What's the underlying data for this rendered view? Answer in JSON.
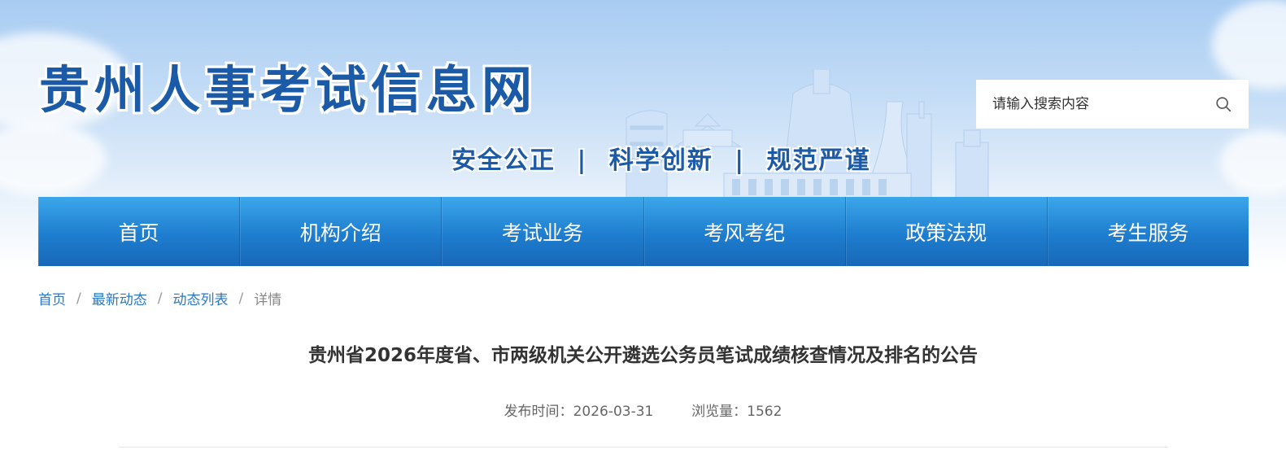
{
  "header": {
    "site_title": "贵州人事考试信息网",
    "slogan": {
      "part1": "安全公正",
      "part2": "科学创新",
      "part3": "规范严谨",
      "separator": "|"
    },
    "search": {
      "placeholder": "请输入搜索内容",
      "icon": "search-icon"
    }
  },
  "nav": {
    "items": [
      {
        "label": "首页"
      },
      {
        "label": "机构介绍"
      },
      {
        "label": "考试业务"
      },
      {
        "label": "考风考纪"
      },
      {
        "label": "政策法规"
      },
      {
        "label": "考生服务"
      }
    ]
  },
  "breadcrumb": {
    "items": [
      "首页",
      "最新动态",
      "动态列表"
    ],
    "current": "详情",
    "separator": "/"
  },
  "article": {
    "title": "贵州省2026年度省、市两级机关公开遴选公务员笔试成绩核查情况及排名的公告",
    "publish_label": "发布时间：",
    "publish_date": "2026-03-31",
    "views_label": "浏览量：",
    "views": "1562"
  },
  "colors": {
    "brand_blue": "#1a5aa6",
    "nav_blue": "#1e7dcf",
    "link_blue": "#2b78c2"
  }
}
